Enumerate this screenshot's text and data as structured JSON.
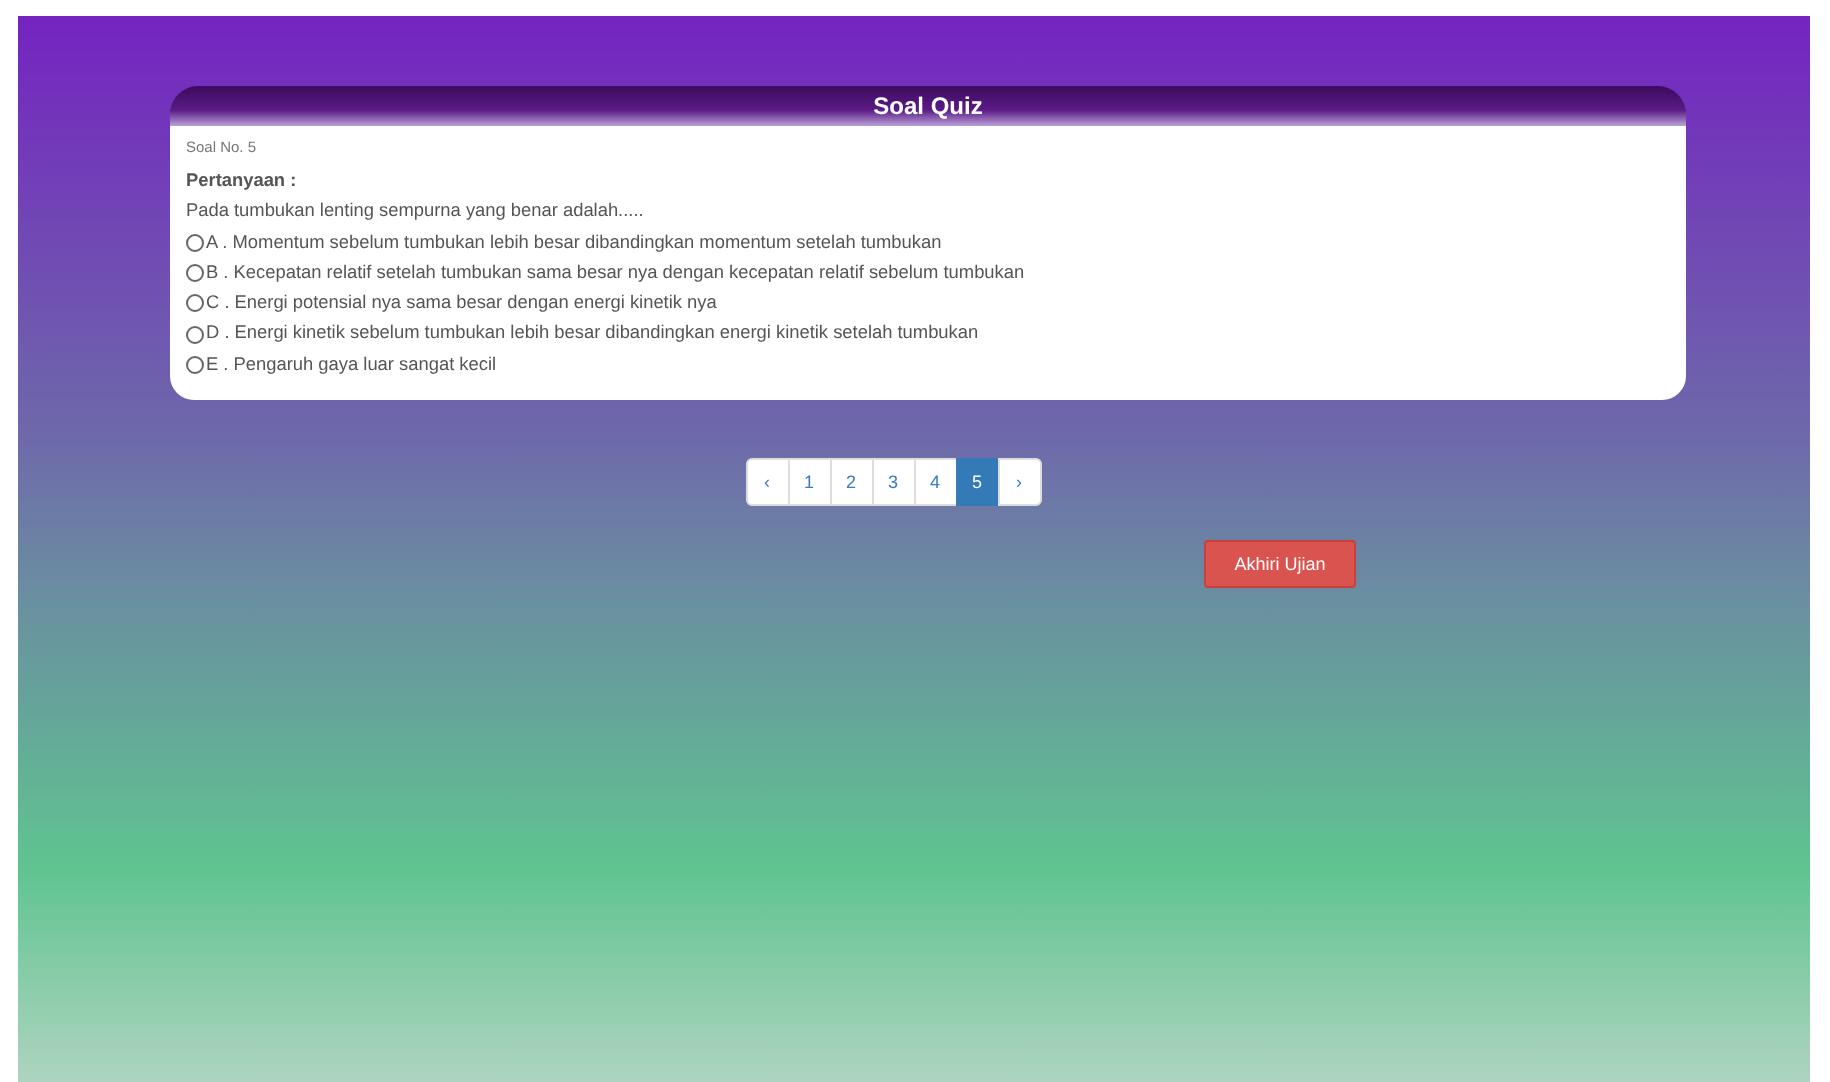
{
  "panel": {
    "title": "Soal Quiz",
    "number": "Soal No. 5",
    "question_label": "Pertanyaan :",
    "question": "Pada tumbukan lenting sempurna yang benar adalah.....",
    "options": [
      {
        "text": "A . Momentum sebelum tumbukan lebih besar dibandingkan momentum setelah tumbukan",
        "selected": false
      },
      {
        "text": "B . Kecepatan relatif setelah tumbukan sama besar nya dengan kecepatan relatif sebelum tumbukan",
        "selected": false
      },
      {
        "text": "C . Energi potensial nya sama besar dengan energi kinetik nya",
        "selected": false
      },
      {
        "text": "D . Energi kinetik sebelum tumbukan lebih besar dibandingkan energi kinetik setelah tumbukan",
        "selected": false
      },
      {
        "text": "E . Pengaruh gaya luar sangat kecil",
        "selected": false
      }
    ]
  },
  "pagination": {
    "prev": "‹",
    "next": "›",
    "pages": [
      {
        "label": "1",
        "selected": false
      },
      {
        "label": "2",
        "selected": false
      },
      {
        "label": "3",
        "selected": false
      },
      {
        "label": "4",
        "selected": false
      },
      {
        "label": "5",
        "selected": true
      }
    ]
  },
  "finish_button": "Akhiri Ujian"
}
